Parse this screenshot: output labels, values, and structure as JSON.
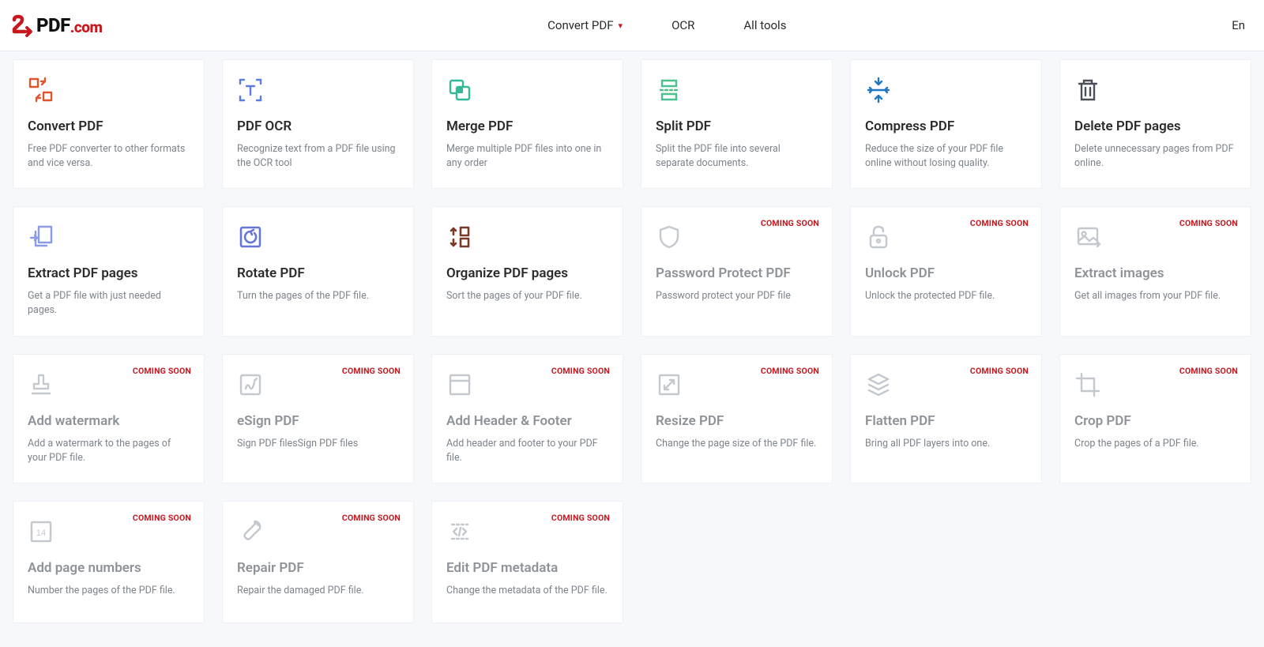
{
  "brand": {
    "pdf": "PDF",
    "com": ".com"
  },
  "nav": {
    "convert": "Convert PDF",
    "ocr": "OCR",
    "alltools": "All tools"
  },
  "lang": "En",
  "badge": "COMING SOON",
  "tools": [
    {
      "title": "Convert PDF",
      "desc": "Free PDF converter to other formats and vice versa."
    },
    {
      "title": "PDF OCR",
      "desc": "Recognize text from a PDF file using the OCR tool"
    },
    {
      "title": "Merge PDF",
      "desc": "Merge multiple PDF files into one in any order"
    },
    {
      "title": "Split PDF",
      "desc": "Split the PDF file into several separate documents."
    },
    {
      "title": "Compress PDF",
      "desc": "Reduce the size of your PDF file online without losing quality."
    },
    {
      "title": "Delete PDF pages",
      "desc": "Delete unnecessary pages from PDF online."
    },
    {
      "title": "Extract PDF pages",
      "desc": "Get a PDF file with just needed pages."
    },
    {
      "title": "Rotate PDF",
      "desc": "Turn the pages of the PDF file."
    },
    {
      "title": "Organize PDF pages",
      "desc": "Sort the pages of your PDF file."
    },
    {
      "title": "Password Protect PDF",
      "desc": "Password protect your PDF file"
    },
    {
      "title": "Unlock PDF",
      "desc": "Unlock the protected PDF file."
    },
    {
      "title": "Extract images",
      "desc": "Get all images from your PDF file."
    },
    {
      "title": "Add watermark",
      "desc": "Add a watermark to the pages of your PDF file."
    },
    {
      "title": "eSign PDF",
      "desc": "Sign PDF filesSign PDF files"
    },
    {
      "title": "Add Header & Footer",
      "desc": "Add header and footer to your PDF file."
    },
    {
      "title": "Resize PDF",
      "desc": "Change the page size of the PDF file."
    },
    {
      "title": "Flatten PDF",
      "desc": "Bring all PDF layers into one."
    },
    {
      "title": "Crop PDF",
      "desc": "Crop the pages of a PDF file."
    },
    {
      "title": "Add page numbers",
      "desc": "Number the pages of the PDF file."
    },
    {
      "title": "Repair PDF",
      "desc": "Repair the damaged PDF file."
    },
    {
      "title": "Edit PDF metadata",
      "desc": "Change the metadata of the PDF file."
    }
  ]
}
